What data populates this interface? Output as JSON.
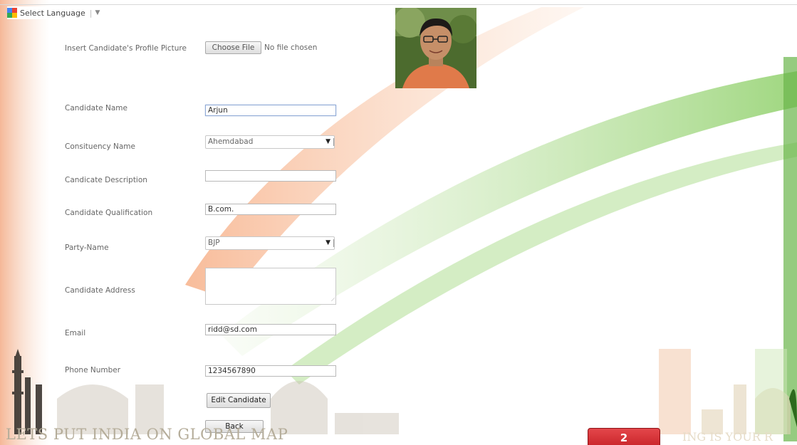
{
  "language_bar": {
    "label": "Select Language",
    "icon": "google-translate-icon"
  },
  "profile_picture": {
    "label": "Insert Candidate's Profile Picture",
    "button_label": "Choose File",
    "file_status": "No file chosen"
  },
  "form": {
    "candidate_name": {
      "label": "Candidate Name",
      "value": "Arjun"
    },
    "constituency": {
      "label": "Consituency Name",
      "selected": "Ahemdabad"
    },
    "description": {
      "label": "Candicate Description",
      "value": ""
    },
    "qualification": {
      "label": "Candidate Qualification",
      "value": "B.com."
    },
    "party": {
      "label": "Party-Name",
      "selected": "BJP"
    },
    "address": {
      "label": "Candidate Address",
      "value": ""
    },
    "email": {
      "label": "Email",
      "value": "ridd@sd.com"
    },
    "phone": {
      "label": "Phone Number",
      "value": "1234567890"
    }
  },
  "buttons": {
    "edit": "Edit Candidate",
    "back": "Back"
  },
  "banner": {
    "slogan": "LETS PUT INDIA ON GLOBAL MAP",
    "slogan_right": "ING IS YOUR R"
  },
  "notification": {
    "count": "2"
  },
  "colors": {
    "saffron": "#f6a26a",
    "green": "#7cc24a",
    "focus": "#8ea9d6"
  }
}
